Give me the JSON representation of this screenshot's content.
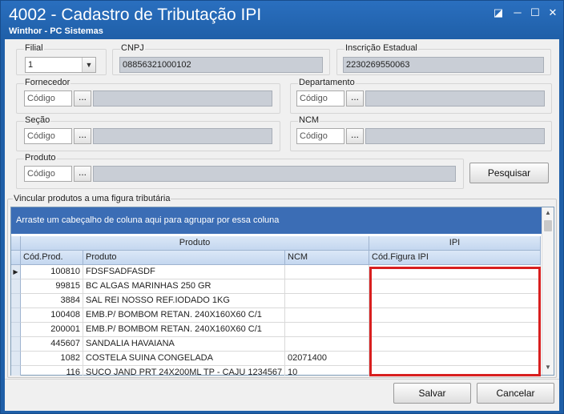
{
  "window": {
    "title": "4002 - Cadastro de Tributação IPI",
    "subtitle": "Winthor - PC Sistemas",
    "controls": [
      "◪",
      "─",
      "☐",
      "✕"
    ]
  },
  "filters": {
    "filial": {
      "label": "Filial",
      "value": "1"
    },
    "cnpj": {
      "label": "CNPJ",
      "value": "08856321000102"
    },
    "inscricao": {
      "label": "Inscrição Estadual",
      "value": "2230269550063"
    },
    "fornecedor": {
      "label": "Fornecedor",
      "placeholder": "Código"
    },
    "departamento": {
      "label": "Departamento",
      "placeholder": "Código"
    },
    "secao": {
      "label": "Seção",
      "placeholder": "Código"
    },
    "ncm": {
      "label": "NCM",
      "placeholder": "Código"
    },
    "produto": {
      "label": "Produto",
      "placeholder": "Código"
    },
    "ellipsis": "...",
    "pesquisar_label": "Pesquisar"
  },
  "grid": {
    "group_label": "Vincular produtos a uma figura tributária",
    "group_panel_text": "Arraste um cabeçalho de coluna aqui para agrupar por essa coluna",
    "bands": [
      "Produto",
      "IPI"
    ],
    "columns": [
      "Cód.Prod.",
      "Produto",
      "NCM",
      "Cód.Figura IPI"
    ],
    "current_row_marker": "▶",
    "rows": [
      {
        "cod": "100810",
        "produto": "FDSFSADFASDF",
        "ncm": "",
        "figura": ""
      },
      {
        "cod": "99815",
        "produto": "BC ALGAS MARINHAS 250 GR",
        "ncm": "",
        "figura": ""
      },
      {
        "cod": "3884",
        "produto": "SAL REI NOSSO REF.IODADO 1KG",
        "ncm": "",
        "figura": ""
      },
      {
        "cod": "100408",
        "produto": "EMB.P/ BOMBOM RETAN. 240X160X60 C/1",
        "ncm": "",
        "figura": ""
      },
      {
        "cod": "200001",
        "produto": "EMB.P/ BOMBOM RETAN. 240X160X60 C/1",
        "ncm": "",
        "figura": ""
      },
      {
        "cod": "445607",
        "produto": "SANDALIA HAVAIANA",
        "ncm": "",
        "figura": ""
      },
      {
        "cod": "1082",
        "produto": "COSTELA SUINA CONGELADA",
        "ncm": "02071400",
        "figura": ""
      },
      {
        "cod": "116",
        "produto": "SUCO JAND PRT 24X200ML TP - CAJU 1234567",
        "ncm": "10",
        "figura": ""
      }
    ],
    "scroll_up": "▲",
    "scroll_down": "▼"
  },
  "footer": {
    "salvar_label": "Salvar",
    "cancelar_label": "Cancelar"
  },
  "colors": {
    "title_bar": "#1f5fa8",
    "group_panel": "#3b6db5",
    "highlight": "#d81f1f"
  }
}
